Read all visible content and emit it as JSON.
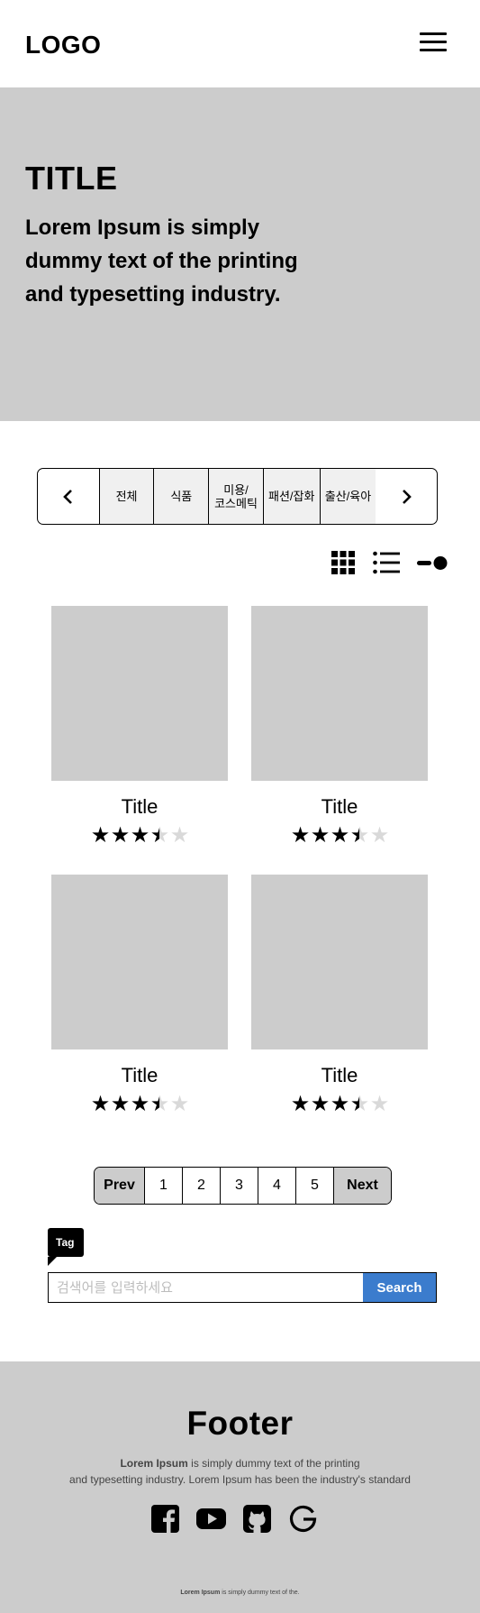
{
  "header": {
    "logo": "LOGO",
    "menu_icon": "hamburger-menu-icon"
  },
  "hero": {
    "title": "TITLE",
    "text": "Lorem Ipsum is simply dummy text of the printing and typesetting industry."
  },
  "categories": {
    "prev_icon": "chevron-left-icon",
    "next_icon": "chevron-right-icon",
    "items": [
      {
        "label": "전체"
      },
      {
        "label": "식품"
      },
      {
        "label": "미용/\n코스메틱"
      },
      {
        "label": "패션/잡화"
      },
      {
        "label": "출산/육아"
      }
    ]
  },
  "view_toggle": {
    "grid_icon": "grid-view-icon",
    "list_icon": "list-view-icon",
    "slider_icon": "slider-view-icon"
  },
  "products": [
    {
      "title": "Title",
      "rating": 3.5,
      "max_rating": 5
    },
    {
      "title": "Title",
      "rating": 3.5,
      "max_rating": 5
    },
    {
      "title": "Title",
      "rating": 3.5,
      "max_rating": 5
    },
    {
      "title": "Title",
      "rating": 3.5,
      "max_rating": 5
    }
  ],
  "pagination": {
    "prev": "Prev",
    "pages": [
      "1",
      "2",
      "3",
      "4",
      "5"
    ],
    "next": "Next"
  },
  "tag": {
    "label": "Tag"
  },
  "search": {
    "placeholder": "검색어를 입력하세요",
    "value": "",
    "button": "Search"
  },
  "footer": {
    "title": "Footer",
    "text_bold": "Lorem Ipsum",
    "text_line1": " is simply dummy text of the printing",
    "text_line2": "and typesetting industry. Lorem Ipsum has been the industry's standard",
    "social_icons": [
      "facebook-icon",
      "youtube-icon",
      "github-icon",
      "google-icon"
    ],
    "small_bold": "Lorem Ipsum",
    "small_text": " is simply dummy text of the."
  },
  "colors": {
    "placeholder_gray": "#cccccc",
    "search_button": "#3b7ccd"
  }
}
